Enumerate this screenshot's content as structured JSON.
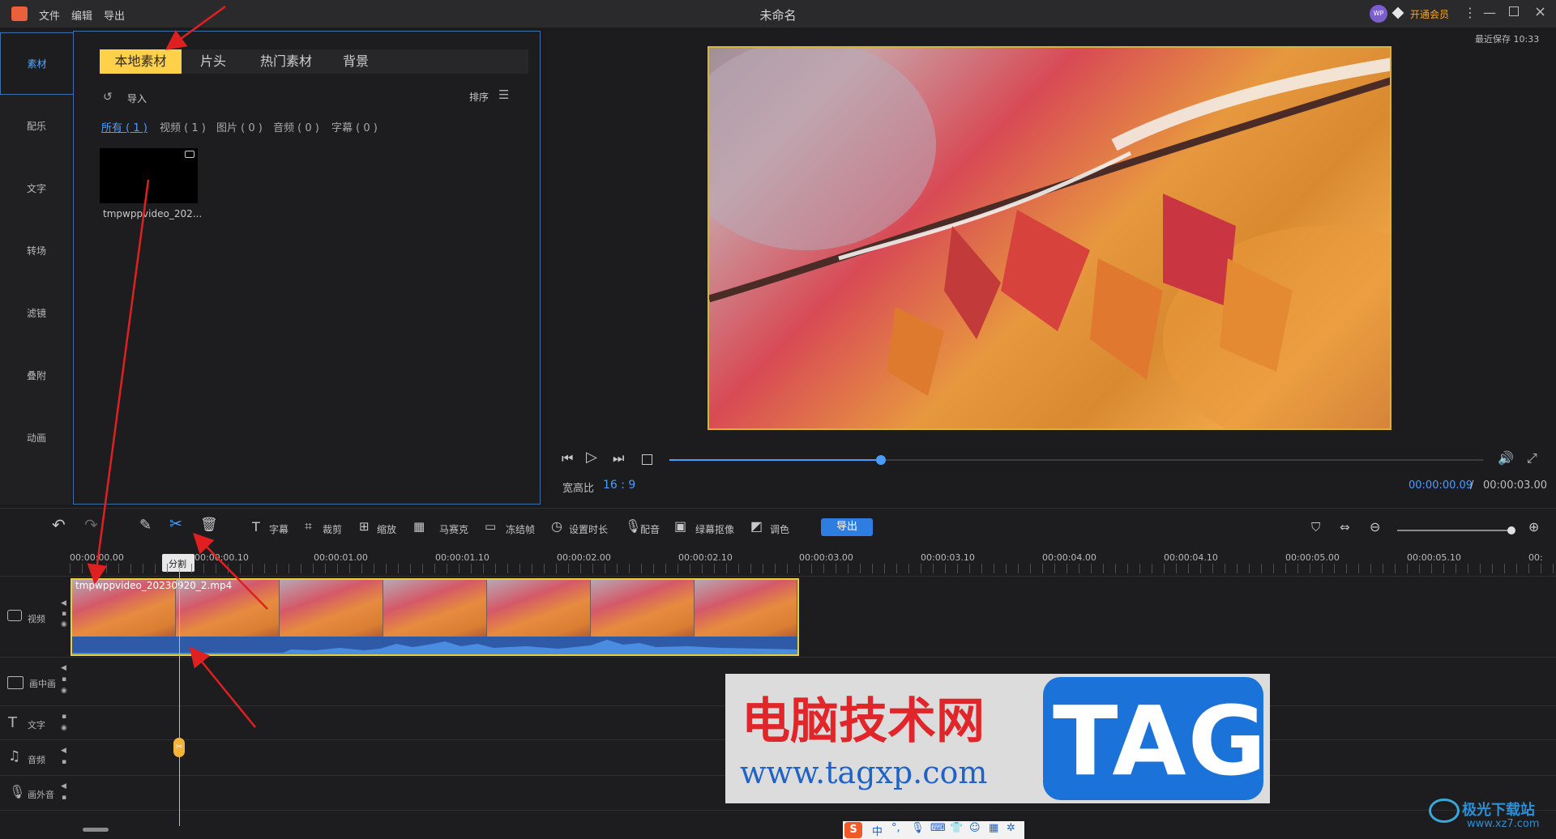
{
  "app": {
    "menu": [
      "文件",
      "编辑",
      "导出"
    ],
    "title": "未命名",
    "vip_label": "开通会员",
    "last_saved": "最近保存 10:33"
  },
  "sidebar": {
    "items": [
      {
        "label": "素材"
      },
      {
        "label": "配乐"
      },
      {
        "label": "文字"
      },
      {
        "label": "转场"
      },
      {
        "label": "滤镜"
      },
      {
        "label": "叠附"
      },
      {
        "label": "动画"
      }
    ]
  },
  "library": {
    "tabs": [
      "本地素材",
      "片头",
      "热门素材",
      "背景"
    ],
    "import_label": "导入",
    "sort_label": "排序",
    "filters": [
      "所有 ( 1 )",
      "视频 ( 1 )",
      "图片 ( 0 )",
      "音频 ( 0 )",
      "字幕 ( 0 )"
    ],
    "clip_name": "tmpwppvideo_202..."
  },
  "preview": {
    "aspect_label": "宽高比",
    "aspect_value": "16 : 9",
    "current_time": "00:00:00.09",
    "separator": "/",
    "total_time": "00:00:03.00",
    "progress": 0.26
  },
  "toolbar": {
    "tools": [
      "字幕",
      "裁剪",
      "缩放",
      "马赛克",
      "冻结帧",
      "设置时长",
      "配音",
      "绿幕抠像",
      "调色"
    ],
    "export_label": "导出",
    "split_tooltip": "分割"
  },
  "timeline": {
    "ruler": [
      "00:00:00.00",
      "00:00:00.10",
      "00:00:01.00",
      "00:00:01.10",
      "00:00:02.00",
      "00:00:02.10",
      "00:00:03.00",
      "00:00:03.10",
      "00:00:04.00",
      "00:00:04.10",
      "00:00:05.00",
      "00:00:05.10",
      "00:"
    ],
    "tracks": [
      "视频",
      "画中画",
      "文字",
      "音频",
      "画外音"
    ],
    "video_clip_name": "tmpwppvideo_20230920_2.mp4"
  },
  "watermark": {
    "site_name": "电脑技术网",
    "tag": "TAG",
    "url": "www.tagxp.com",
    "corner_brand": "极光下载站",
    "corner_url": "www.xz7.com"
  },
  "ime": {
    "lang": "中"
  },
  "colors": {
    "accent_blue": "#4a9dff",
    "tab_yellow": "#ffd04a",
    "export_button": "#2f7de1",
    "annotation_red": "#e02020"
  }
}
